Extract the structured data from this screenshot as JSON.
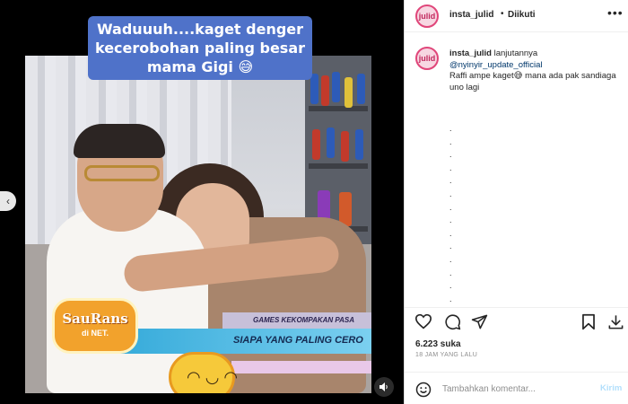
{
  "media": {
    "caption": "Waduuuh....kaget denger kecerobohan paling besar mama Gigi 😅",
    "show_logo": "SauRans",
    "show_logo_sub": "di NET.",
    "banner_line1": "GAMES KEKOMPAKAN PASA",
    "banner_line2": "SIAPA YANG PALING CERO",
    "prev_icon": "chevron-left-icon",
    "mute_icon": "speaker-icon"
  },
  "header": {
    "avatar_text": "julid",
    "username": "insta_julid",
    "separator": "•",
    "follow_status": "Diikuti",
    "more_icon": "more-horizontal-icon"
  },
  "post": {
    "avatar_text": "julid",
    "username": "insta_julid",
    "text_lead": "lanjutannya",
    "mention": "@nyinyir_update_official",
    "text_body": "Raffi ampe kaget😅 mana ada pak sandiaga uno lagi",
    "dots": [
      ".",
      ".",
      ".",
      ".",
      ".",
      ".",
      ".",
      ".",
      ".",
      ".",
      ".",
      ".",
      ".",
      "."
    ]
  },
  "actions": {
    "like_icon": "heart-icon",
    "comment_icon": "comment-icon",
    "share_icon": "send-icon",
    "save_icon": "bookmark-icon",
    "download_icon": "download-icon"
  },
  "stats": {
    "likes": "6.223 suka",
    "timestamp": "18 JAM YANG LALU"
  },
  "comment_box": {
    "emoji_icon": "smiley-icon",
    "placeholder": "Tambahkan komentar...",
    "send_label": "Kirim"
  }
}
